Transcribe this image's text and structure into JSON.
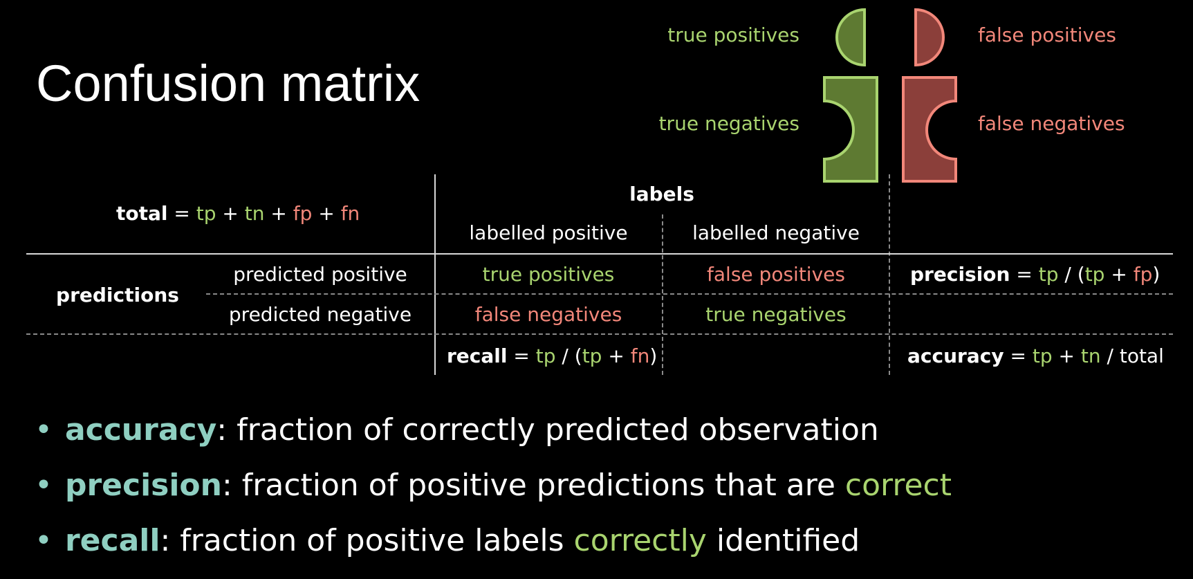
{
  "title": "Confusion matrix",
  "legend": {
    "true_positives": "true positives",
    "false_positives": "false positives",
    "true_negatives": "true negatives",
    "false_negatives": "false negatives"
  },
  "colors": {
    "true_fill": "#5e7a32",
    "true_stroke": "#a9d46f",
    "false_fill": "#8b3f3a",
    "false_stroke": "#f2877a",
    "bold_term": "#8fcfc1"
  },
  "total_formula": {
    "term": "total",
    "eq": " = ",
    "a": "tp",
    "p1": " + ",
    "b": "tn",
    "p2": " + ",
    "c": "fp",
    "p3": " + ",
    "d": "fn"
  },
  "labels_header": "labels",
  "col_pos": "labelled positive",
  "col_neg": "labelled negative",
  "predictions": "predictions",
  "row_pos": "predicted positive",
  "row_neg": "predicted negative",
  "cells": {
    "tp": "true positives",
    "fp": "false positives",
    "fn": "false negatives",
    "tn": "true negatives"
  },
  "precision_formula": {
    "term": "precision",
    "eq": " = ",
    "a": "tp",
    "s1": " / (",
    "b": "tp",
    "p": " + ",
    "c": "fp",
    "s2": ")"
  },
  "recall_formula": {
    "term": "recall",
    "eq": " = ",
    "a": "tp",
    "s1": " / (",
    "b": "tp",
    "p": " + ",
    "c": "fn",
    "s2": ")"
  },
  "accuracy_formula": {
    "term": "accuracy",
    "eq": " = ",
    "a": "tp",
    "p": " + ",
    "b": "tn",
    "s": " / total"
  },
  "bullets": [
    {
      "term": "accuracy",
      "text": ": fraction of correctly predicted observation",
      "hl": "",
      "tail": ""
    },
    {
      "term": "precision",
      "text": ": fraction of positive predictions that are ",
      "hl": "correct",
      "tail": ""
    },
    {
      "term": "recall",
      "text": ": fraction of positive labels ",
      "hl": "correctly",
      "tail": " identified"
    }
  ]
}
